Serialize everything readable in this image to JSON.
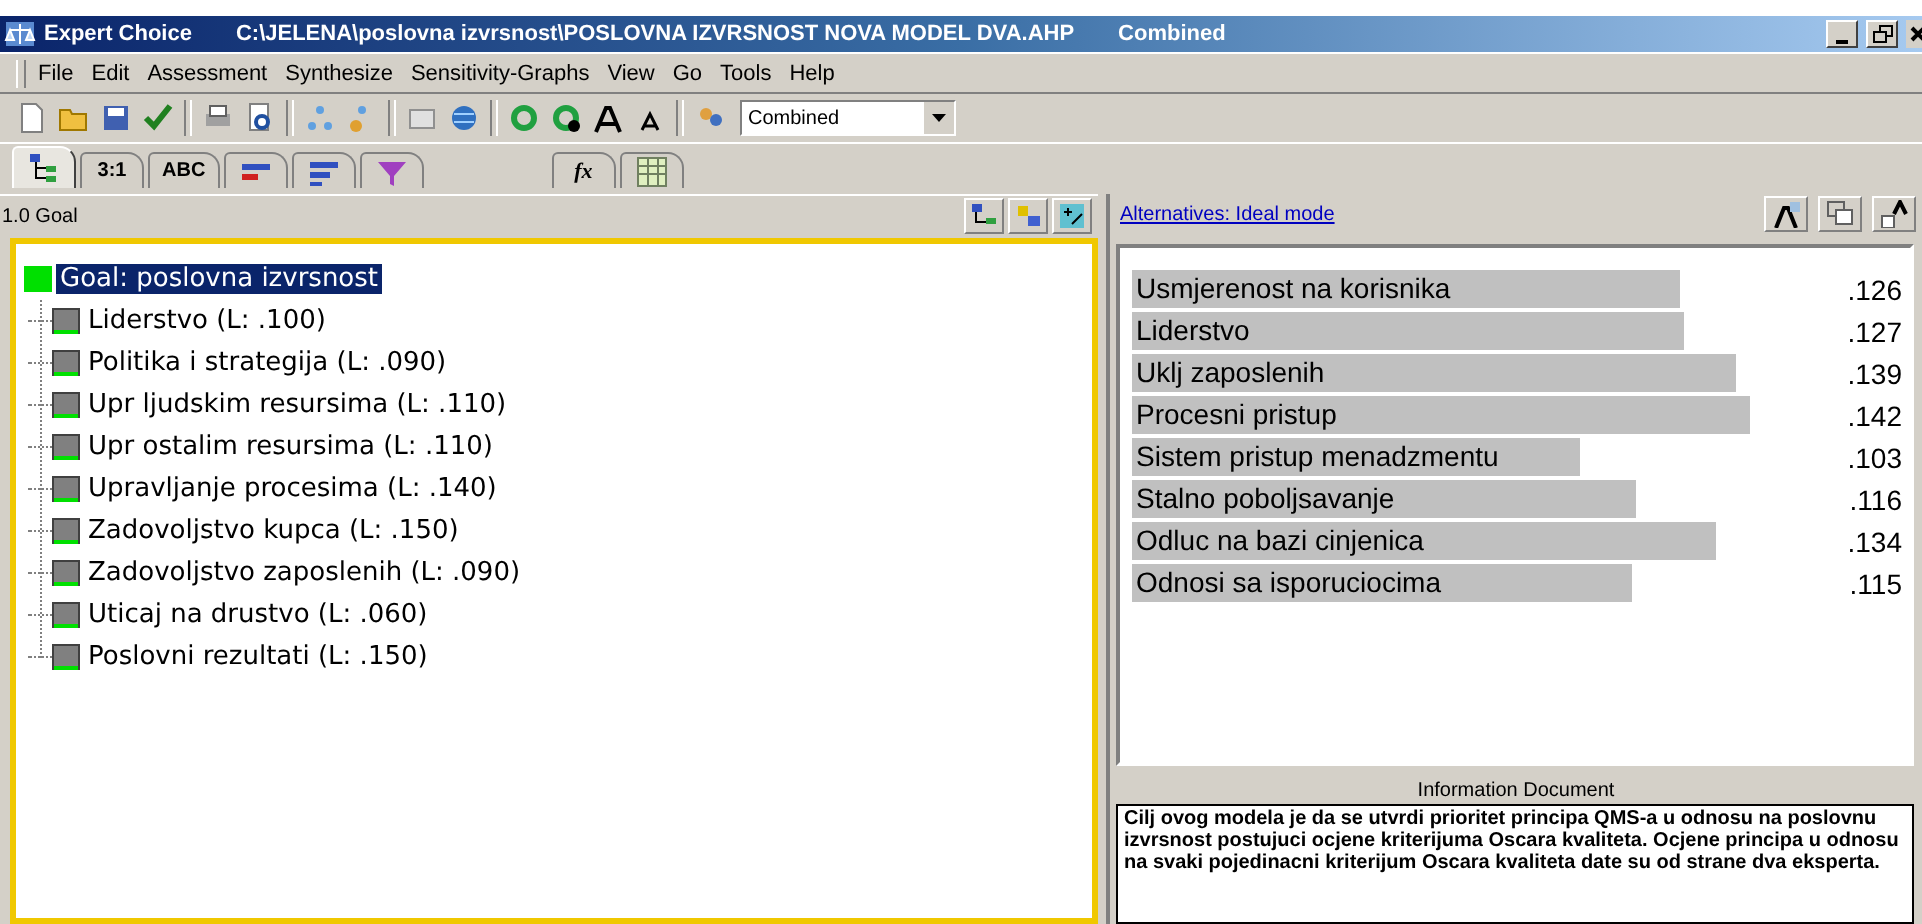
{
  "window": {
    "app": "Expert Choice",
    "path": "C:\\JELENA\\poslovna izvrsnost\\POSLOVNA IZVRSNOST NOVA MODEL DVA.AHP",
    "mode": "Combined"
  },
  "menu": [
    "File",
    "Edit",
    "Assessment",
    "Synthesize",
    "Sensitivity-Graphs",
    "View",
    "Go",
    "Tools",
    "Help"
  ],
  "toolbar": {
    "combo_value": "Combined"
  },
  "tabs": [
    {
      "kind": "icon",
      "selected": true
    },
    {
      "kind": "text",
      "label": "3:1",
      "selected": false
    },
    {
      "kind": "text",
      "label": "ABC",
      "selected": false
    },
    {
      "kind": "icon",
      "selected": false
    },
    {
      "kind": "icon",
      "selected": false
    },
    {
      "kind": "icon",
      "selected": false
    },
    {
      "kind": "text",
      "label": "fx",
      "selected": false
    },
    {
      "kind": "icon",
      "selected": false
    }
  ],
  "tree_panel": {
    "node_path": "1.0 Goal",
    "goal": {
      "label": "Goal: poslovna izvrsnost",
      "selected": true
    },
    "children": [
      {
        "label": "Liderstvo (L: .100)",
        "selected": false
      },
      {
        "label": "Politika i strategija (L: .090)",
        "selected": false
      },
      {
        "label": "Upr ljudskim resursima (L: .110)",
        "selected": false
      },
      {
        "label": "Upr ostalim resursima (L: .110)",
        "selected": false
      },
      {
        "label": "Upravljanje procesima (L: .140)",
        "selected": false
      },
      {
        "label": "Zadovoljstvo kupca (L: .150)",
        "selected": false
      },
      {
        "label": "Zadovoljstvo zaposlenih (L: .090)",
        "selected": false
      },
      {
        "label": "Uticaj na drustvo (L: .060)",
        "selected": false
      },
      {
        "label": "Poslovni rezultati (L: .150)",
        "selected": false
      }
    ]
  },
  "alternatives_panel": {
    "header_link": "Alternatives: Ideal mode",
    "alternatives": [
      {
        "name": "Usmjerenost na korisnika",
        "value": ".126"
      },
      {
        "name": "Liderstvo",
        "value": ".127"
      },
      {
        "name": "Uklj zaposlenih",
        "value": ".139"
      },
      {
        "name": "Procesni pristup",
        "value": ".142"
      },
      {
        "name": "Sistem pristup menadzmentu",
        "value": ".103"
      },
      {
        "name": "Stalno poboljsavanje",
        "value": ".116"
      },
      {
        "name": "Odluc na bazi cinjenica",
        "value": ".134"
      },
      {
        "name": "Odnosi sa isporuciocima",
        "value": ".115"
      }
    ]
  },
  "information_document": {
    "title": "Information Document",
    "text": "Cilj ovog modela je da se utvrdi prioritet principa QMS-a u odnosu na poslovnu izvrsnost postujuci ocjene kriterijuma Oscara kvaliteta. Ocjene principa u odnosu na svaki pojedinacni kriterijum Oscara kvaliteta date su od strane dva eksperta."
  }
}
